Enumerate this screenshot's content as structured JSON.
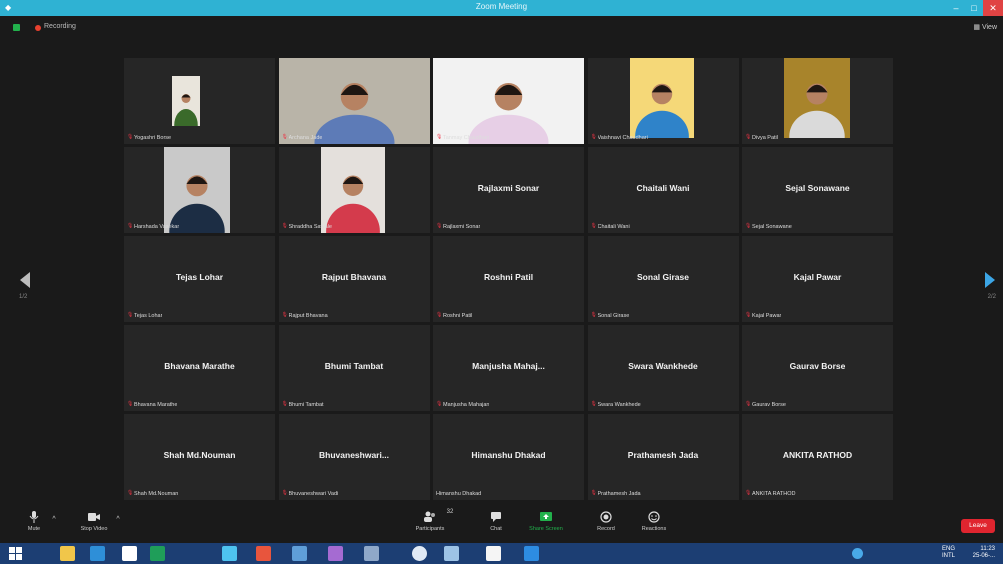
{
  "window": {
    "title": "Zoom Meeting"
  },
  "meeting_bar": {
    "recording_label": "Recording",
    "view_label": "View"
  },
  "nav": {
    "page_left": "1/2",
    "page_right": "2/2"
  },
  "participants": [
    {
      "label": "Yogashri Borse",
      "video": true,
      "bg": "#e9e5dc",
      "shirt": "#3a6a2a"
    },
    {
      "label": "Archana Jade",
      "video": true,
      "bg": "#b9b4a8",
      "shirt": "#5d7bb7"
    },
    {
      "label": "Tanmay Chaudhari",
      "video": true,
      "bg": "#f2f2f2",
      "shirt": "#e7cfe6",
      "active": true
    },
    {
      "label": "Vaishnavi Chaudhari",
      "video": true,
      "bg": "#f5d878",
      "shirt": "#2f83c9"
    },
    {
      "label": "Divya Patil",
      "video": true,
      "bg": "#a8842b",
      "shirt": "#dadada"
    },
    {
      "label": "Harshada Vasekar",
      "video": true,
      "bg": "#c9c9c9",
      "shirt": "#1c2d44"
    },
    {
      "label": "Shraddha Sawale",
      "video": true,
      "bg": "#e4e0dc",
      "shirt": "#d43b4c"
    },
    {
      "name": "Rajlaxmi Sonar",
      "label": "Rajlaxmi Sonar",
      "video": false
    },
    {
      "name": "Chaitali Wani",
      "label": "Chaitali Wani",
      "video": false
    },
    {
      "name": "Sejal Sonawane",
      "label": "Sejal Sonawane",
      "video": false
    },
    {
      "name": "Tejas Lohar",
      "label": "Tejas Lohar",
      "video": false
    },
    {
      "name": "Rajput Bhavana",
      "label": "Rajput Bhavana",
      "video": false
    },
    {
      "name": "Roshni Patil",
      "label": "Roshni Patil",
      "video": false
    },
    {
      "name": "Sonal Girase",
      "label": "Sonal Girase",
      "video": false
    },
    {
      "name": "Kajal Pawar",
      "label": "Kajal Pawar",
      "video": false
    },
    {
      "name": "Bhavana Marathe",
      "label": "Bhavana Marathe",
      "video": false
    },
    {
      "name": "Bhumi Tambat",
      "label": "Bhumi Tambat",
      "video": false
    },
    {
      "name": "Manjusha Mahaj...",
      "label": "Manjusha Mahajan",
      "video": false
    },
    {
      "name": "Swara Wankhede",
      "label": "Swara Wankhede",
      "video": false
    },
    {
      "name": "Gaurav Borse",
      "label": "Gaurav Borse",
      "video": false
    },
    {
      "name": "Shah Md.Nouman",
      "label": "Shah Md.Nouman",
      "video": false
    },
    {
      "name": "Bhuvaneshwari...",
      "label": "Bhuvaneshwari Vadi",
      "video": false
    },
    {
      "name": "Himanshu Dhakad",
      "label": "Himanshu Dhakad",
      "video": false,
      "no_mic": true
    },
    {
      "name": "Prathamesh Jada",
      "label": "Prathamesh Jada",
      "video": false
    },
    {
      "name": "ANKITA RATHOD",
      "label": "ANKITA RATHOD",
      "video": false
    }
  ],
  "toolbar": {
    "mute": "Mute",
    "stop_video": "Stop Video",
    "participants": "Participants",
    "participants_count": "32",
    "chat": "Chat",
    "share_screen": "Share Screen",
    "record": "Record",
    "reactions": "Reactions",
    "leave": "Leave"
  },
  "taskbar": {
    "lang": "ENG",
    "region": "INTL",
    "time": "11:23",
    "date": "25-06-..."
  },
  "colors": {
    "accent": "#2fb2d3",
    "active_speaker": "#c7d84a",
    "leave": "#e0252f",
    "share": "#22b14c"
  }
}
